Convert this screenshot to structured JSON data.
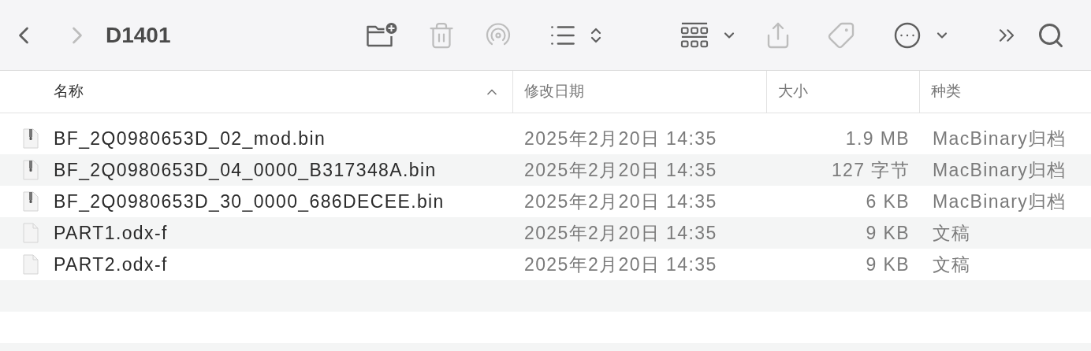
{
  "window": {
    "title": "D1401"
  },
  "toolbar": [
    {
      "kind": "back",
      "disabled": false
    },
    {
      "kind": "forward",
      "disabled": true
    },
    {
      "kind": "new-folder",
      "disabled": false
    },
    {
      "kind": "trash",
      "disabled": true
    },
    {
      "kind": "airdrop",
      "disabled": true
    },
    {
      "kind": "list-view",
      "disabled": false
    },
    {
      "kind": "group",
      "disabled": false
    },
    {
      "kind": "share",
      "disabled": true
    },
    {
      "kind": "tag",
      "disabled": true
    },
    {
      "kind": "more",
      "disabled": false
    },
    {
      "kind": "overflow",
      "disabled": false
    },
    {
      "kind": "search",
      "disabled": false
    }
  ],
  "table": {
    "columns": [
      {
        "label": "名称",
        "sorted": true
      },
      {
        "label": "修改日期",
        "sorted": false
      },
      {
        "label": "大小",
        "sorted": false
      },
      {
        "label": "种类",
        "sorted": false
      }
    ],
    "rows": [
      {
        "kind": "archive",
        "name": "BF_2Q0980653D_02_mod.bin",
        "modified": "2025年2月20日 14:35",
        "size": "1.9 MB",
        "type": "MacBinary归档"
      },
      {
        "kind": "archive",
        "name": "BF_2Q0980653D_04_0000_B317348A.bin",
        "modified": "2025年2月20日 14:35",
        "size": "127 字节",
        "type": "MacBinary归档"
      },
      {
        "kind": "archive",
        "name": "BF_2Q0980653D_30_0000_686DECEE.bin",
        "modified": "2025年2月20日 14:35",
        "size": "6 KB",
        "type": "MacBinary归档"
      },
      {
        "kind": "document",
        "name": "PART1.odx-f",
        "modified": "2025年2月20日 14:35",
        "size": "9 KB",
        "type": "文稿"
      },
      {
        "kind": "document",
        "name": "PART2.odx-f",
        "modified": "2025年2月20日 14:35",
        "size": "9 KB",
        "type": "文稿"
      }
    ]
  }
}
